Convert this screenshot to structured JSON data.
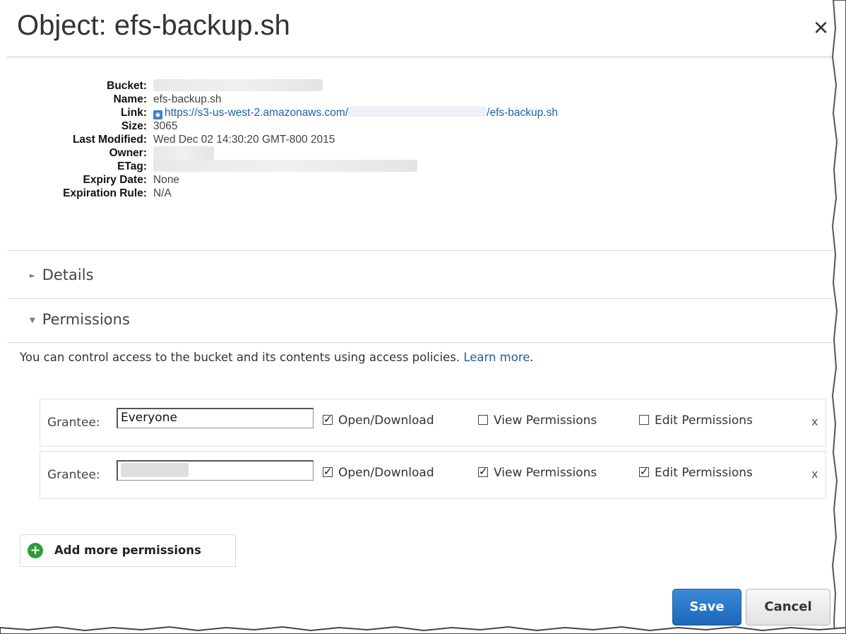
{
  "title": "Object: efs-backup.sh",
  "close_label": "×",
  "properties": [
    {
      "key": "Bucket:",
      "value": ""
    },
    {
      "key": "Name:",
      "value": "efs-backup.sh"
    },
    {
      "key": "Link:",
      "value_prefix": "https://s3-us-west-2.amazonaws.com/",
      "value_suffix": "/efs-backup.sh"
    },
    {
      "key": "Size:",
      "value": "3065"
    },
    {
      "key": "Last Modified:",
      "value": "Wed Dec 02 14:30:20 GMT-800 2015"
    },
    {
      "key": "Owner:",
      "value": ""
    },
    {
      "key": "ETag:",
      "value": ""
    },
    {
      "key": "Expiry Date:",
      "value": "None"
    },
    {
      "key": "Expiration Rule:",
      "value": "N/A"
    }
  ],
  "sections": {
    "details": "Details",
    "permissions": "Permissions"
  },
  "intro": {
    "text": "You can control access to the bucket and its contents using access policies.",
    "link": "Learn more",
    "end": "."
  },
  "grantees": [
    {
      "label": "Grantee:",
      "value": "Everyone",
      "open": "Open/Download",
      "view": "View Permissions",
      "edit": "Edit Permissions",
      "remove": "x"
    },
    {
      "label": "Grantee:",
      "value": "",
      "open": "Open/Download",
      "view": "View Permissions",
      "edit": "Edit Permissions",
      "remove": "x"
    }
  ],
  "add_more": "Add more permissions",
  "buttons": {
    "save": "Save",
    "cancel": "Cancel"
  },
  "colors": {
    "accent": "#1d5fa6",
    "save_blue": "#2a78c8",
    "add_green": "#2f9a3c"
  }
}
